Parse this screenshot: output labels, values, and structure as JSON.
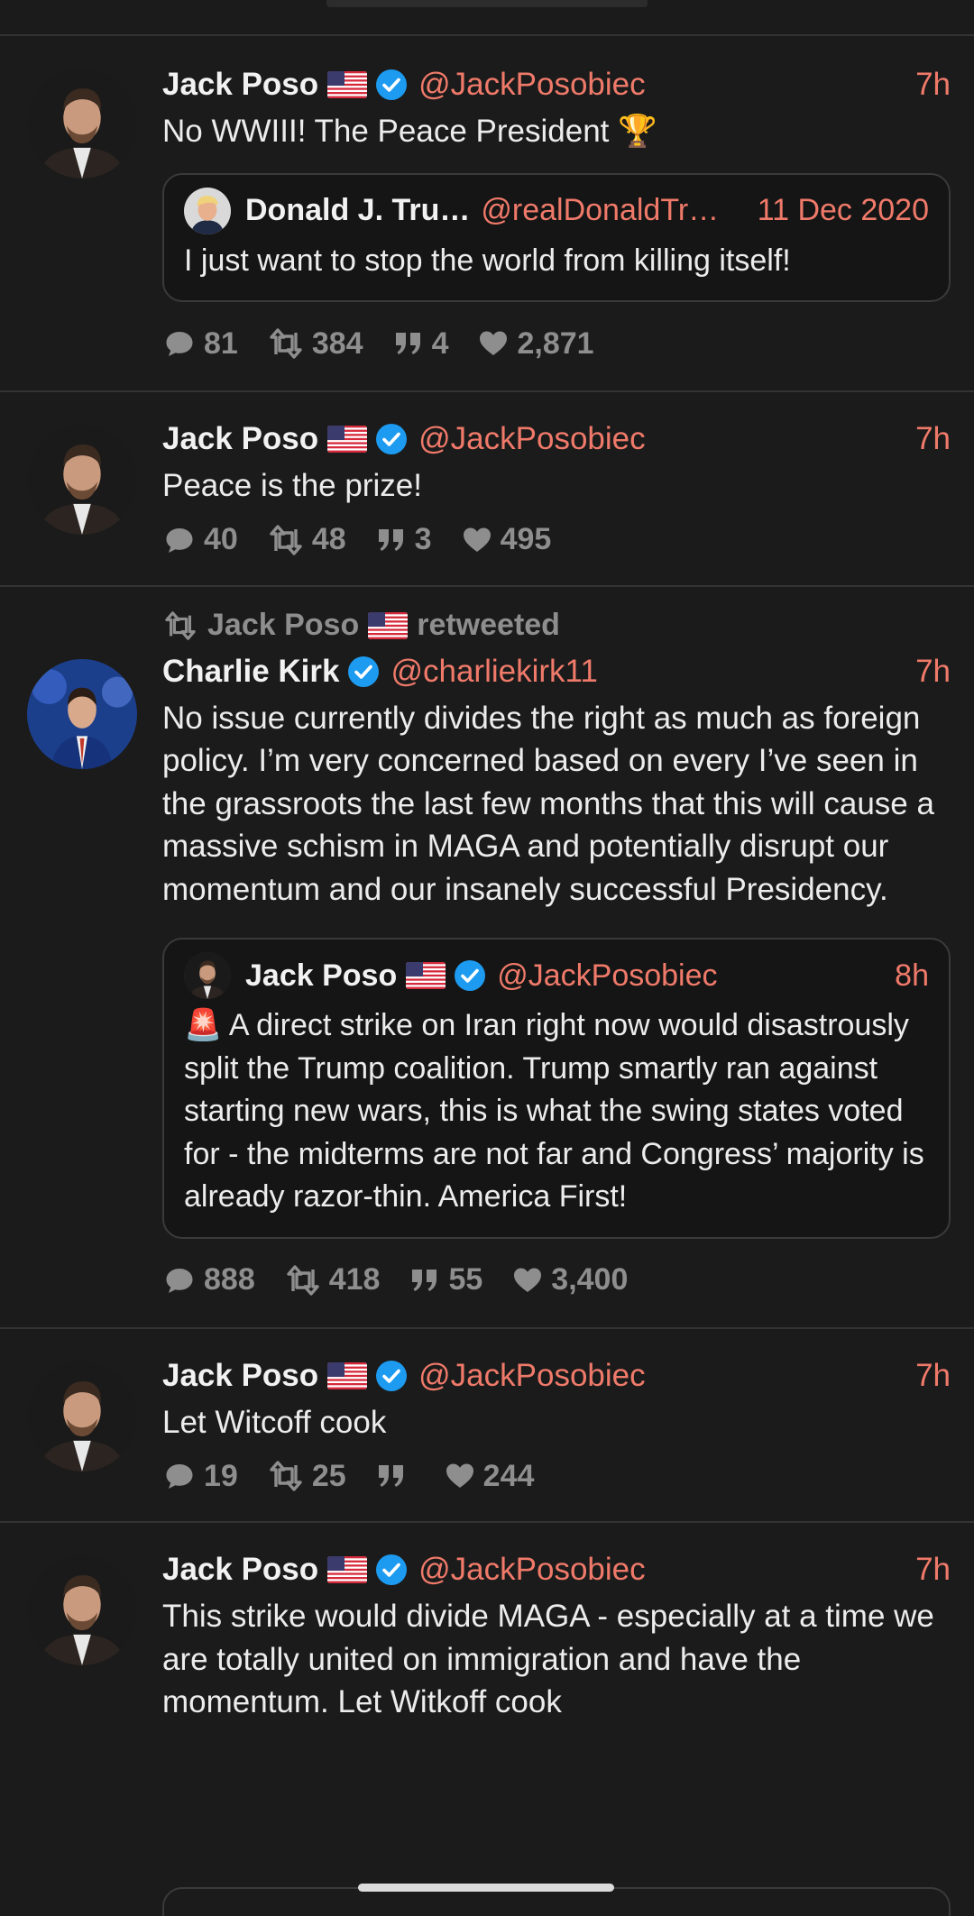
{
  "tweets": [
    {
      "author": "Jack Poso",
      "handle": "@JackPosobiec",
      "time": "7h",
      "text": "No WWIII! The Peace President 🏆",
      "quote": {
        "author": "Donald J. Tru…",
        "handle": "@realDonaldTr…",
        "time": "11 Dec 2020",
        "text": "I just want to stop the world from killing itself!"
      },
      "replies": "81",
      "retweets": "384",
      "quotes": "4",
      "likes": "2,871"
    },
    {
      "author": "Jack Poso",
      "handle": "@JackPosobiec",
      "time": "7h",
      "text": "Peace is the prize!",
      "replies": "40",
      "retweets": "48",
      "quotes": "3",
      "likes": "495"
    },
    {
      "retweeted_by": "Jack Poso",
      "retweeted_suffix": "retweeted",
      "author": "Charlie Kirk",
      "handle": "@charliekirk11",
      "time": "7h",
      "text": "No issue currently divides the right as much as foreign policy. I’m very concerned based on every I’ve seen in the grassroots the last few months that this will cause a massive schism in MAGA and potentially disrupt our momentum and our insanely successful Presidency.",
      "quote": {
        "author": "Jack Poso",
        "handle": "@JackPosobiec",
        "time": "8h",
        "text": "🚨 A direct strike on Iran right now would disastrously split the Trump coalition. Trump smartly ran against starting new wars, this is what the swing states voted for - the midterms are not far and Congress’ majority is already razor-thin. America First!"
      },
      "replies": "888",
      "retweets": "418",
      "quotes": "55",
      "likes": "3,400"
    },
    {
      "author": "Jack Poso",
      "handle": "@JackPosobiec",
      "time": "7h",
      "text": "Let Witcoff cook",
      "replies": "19",
      "retweets": "25",
      "quotes": "",
      "likes": "244"
    },
    {
      "author": "Jack Poso",
      "handle": "@JackPosobiec",
      "time": "7h",
      "text": "This strike would divide MAGA - especially at a time we are totally united on immigration and have the momentum. Let Witkoff cook"
    }
  ],
  "colors": {
    "background": "#1b1b1b",
    "accent": "#f07a6a",
    "verified": "#1d9bf0",
    "muted": "#8e8e8e"
  },
  "icons": [
    "reply-icon",
    "retweet-icon",
    "quote-icon",
    "like-icon",
    "verified-badge-icon",
    "us-flag-icon"
  ]
}
